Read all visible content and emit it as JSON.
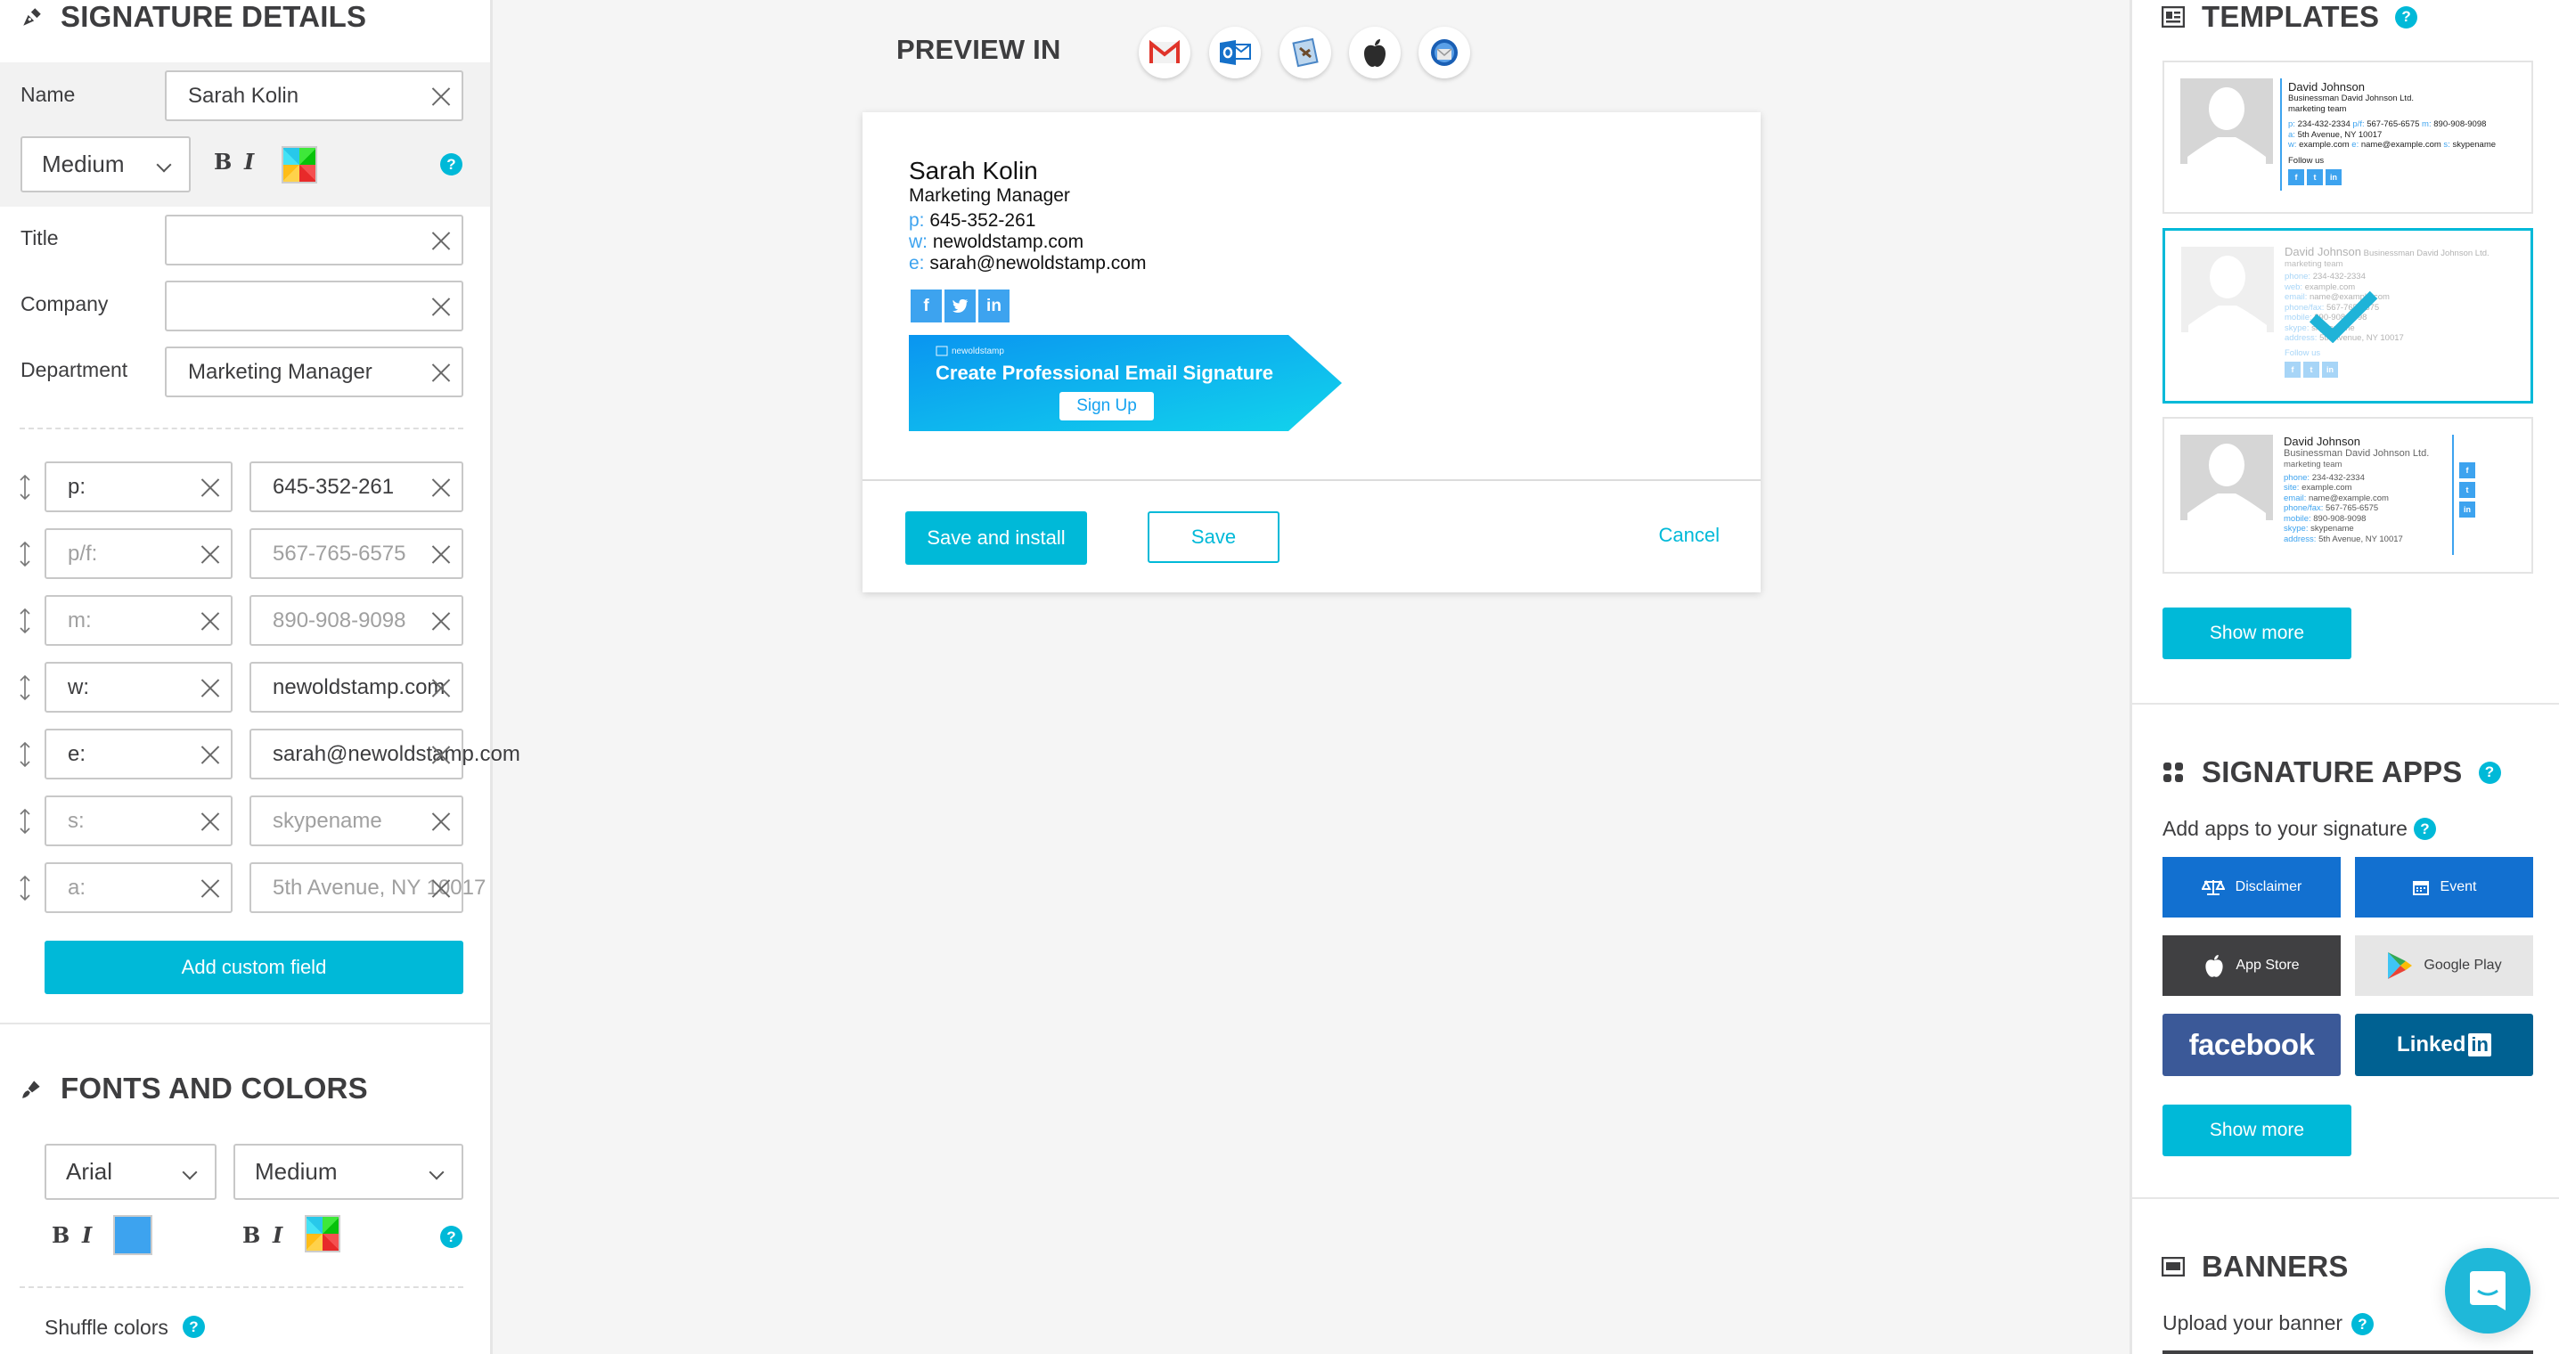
{
  "signature_details": {
    "title": "SIGNATURE DETAILS",
    "name_label": "Name",
    "name_value": "Sarah Kolin",
    "name_size": "Medium",
    "bold": "B",
    "italic": "I",
    "help": "?",
    "fields": [
      {
        "label": "Title",
        "value": ""
      },
      {
        "label": "Company",
        "value": ""
      },
      {
        "label": "Department",
        "value": "Marketing Manager"
      }
    ],
    "contact_rows": [
      {
        "prefix": "p:",
        "prefix_placeholder": false,
        "value": "645-352-261",
        "value_placeholder": false
      },
      {
        "prefix": "p/f:",
        "prefix_placeholder": true,
        "value": "567-765-6575",
        "value_placeholder": true
      },
      {
        "prefix": "m:",
        "prefix_placeholder": true,
        "value": "890-908-9098",
        "value_placeholder": true
      },
      {
        "prefix": "w:",
        "prefix_placeholder": false,
        "value": "newoldstamp.com",
        "value_placeholder": false
      },
      {
        "prefix": "e:",
        "prefix_placeholder": false,
        "value": "sarah@newoldstamp.com",
        "value_placeholder": false
      },
      {
        "prefix": "s:",
        "prefix_placeholder": true,
        "value": "skypename",
        "value_placeholder": true
      },
      {
        "prefix": "a:",
        "prefix_placeholder": true,
        "value": "5th Avenue, NY 10017",
        "value_placeholder": true
      }
    ],
    "add_custom_field": "Add custom field"
  },
  "fonts_and_colors": {
    "title": "FONTS AND COLORS",
    "font_family": "Arial",
    "font_size": "Medium",
    "bold": "B",
    "italic": "I",
    "primary_color": "#3da3ef",
    "shuffle_label": "Shuffle colors",
    "help": "?"
  },
  "preview": {
    "label": "PREVIEW IN",
    "clients": [
      "gmail-icon",
      "outlook-icon",
      "apple-mail-icon",
      "apple-icon",
      "thunderbird-icon"
    ],
    "signature": {
      "name": "Sarah Kolin",
      "title": "Marketing Manager",
      "lines": [
        {
          "key": "p:",
          "value": "645-352-261"
        },
        {
          "key": "w:",
          "value": "newoldstamp.com"
        },
        {
          "key": "e:",
          "value": "sarah@newoldstamp.com"
        }
      ],
      "social": [
        "f",
        "t",
        "in"
      ]
    },
    "banner": {
      "brand": "newoldstamp",
      "headline": "Create Professional Email Signature",
      "cta": "Sign Up"
    },
    "save_install": "Save and install",
    "save": "Save",
    "cancel": "Cancel"
  },
  "templates": {
    "title": "TEMPLATES",
    "help": "?",
    "items": [
      {
        "name": "David Johnson",
        "company": "Businessman David Johnson Ltd.",
        "team": "marketing team",
        "line1": [
          {
            "k": "p:",
            "v": "234-432-2334"
          },
          {
            "k": "p/f:",
            "v": "567-765-6575"
          },
          {
            "k": "m:",
            "v": "890-908-9098"
          }
        ],
        "line2": [
          {
            "k": "a:",
            "v": "5th Avenue, NY 10017"
          }
        ],
        "line3": [
          {
            "k": "w:",
            "v": "example.com"
          },
          {
            "k": "e:",
            "v": "name@example.com"
          },
          {
            "k": "s:",
            "v": "skypename"
          }
        ],
        "follow": "Follow us"
      },
      {
        "name": "David Johnson",
        "company": "Businessman David Johnson Ltd.",
        "team": "marketing team",
        "lines": [
          {
            "k": "phone:",
            "v": "234-432-2334"
          },
          {
            "k": "web:",
            "v": "example.com"
          },
          {
            "k": "email:",
            "v": "name@example.com"
          },
          {
            "k": "phone/fax:",
            "v": "567-765-6575"
          },
          {
            "k": "mobile:",
            "v": "890-908-9098"
          },
          {
            "k": "skype:",
            "v": "skypename"
          },
          {
            "k": "address:",
            "v": "5th Avenue, NY 10017"
          }
        ],
        "follow": "Follow us",
        "selected": true
      },
      {
        "name": "David Johnson",
        "company": "Businessman David Johnson Ltd.",
        "team": "marketing team",
        "lines": [
          {
            "k": "phone:",
            "v": "234-432-2334"
          },
          {
            "k": "site:",
            "v": "example.com"
          },
          {
            "k": "email:",
            "v": "name@example.com"
          },
          {
            "k": "phone/fax:",
            "v": "567-765-6575"
          },
          {
            "k": "mobile:",
            "v": "890-908-9098"
          },
          {
            "k": "skype:",
            "v": "skypename"
          },
          {
            "k": "address:",
            "v": "5th Avenue, NY 10017"
          }
        ]
      }
    ],
    "show_more": "Show more"
  },
  "signature_apps": {
    "title": "SIGNATURE APPS",
    "help": "?",
    "subtitle": "Add apps to your signature",
    "apps": [
      {
        "label": "Disclaimer",
        "color": "#1270d0"
      },
      {
        "label": "Event",
        "color": "#1270d0"
      },
      {
        "label": "App Store",
        "color": "#404042"
      },
      {
        "label": "Google Play",
        "color": "#e6e6e6"
      },
      {
        "label": "facebook",
        "color": "#3b5998"
      },
      {
        "label": "Linked",
        "label_suffix": "in",
        "color": "#006192"
      }
    ],
    "show_more": "Show more"
  },
  "banners": {
    "title": "BANNERS",
    "upload_label": "Upload your banner",
    "help": "?"
  },
  "accent_color": "#00b9d8"
}
